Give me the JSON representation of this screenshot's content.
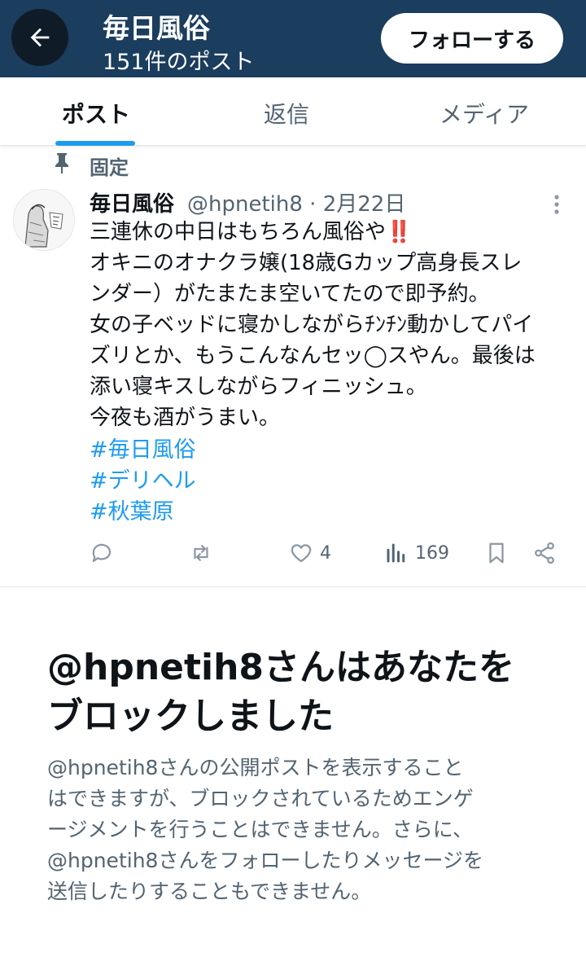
{
  "header": {
    "title": "毎日風俗",
    "post_count": "151件のポスト",
    "follow_label": "フォローする",
    "back_icon": "arrow-left-icon",
    "bg_color": "#1b3d5e"
  },
  "tabs": [
    {
      "label": "ポスト",
      "active": true
    },
    {
      "label": "返信",
      "active": false
    },
    {
      "label": "メディア",
      "active": false
    }
  ],
  "pinned_label": "固定",
  "tweet": {
    "display_name": "毎日風俗",
    "handle_date": "@hpnetih8 · 2月22日",
    "body_lines": [
      "三連休の中日はもちろん風俗や‼️",
      "オキニのオナクラ嬢(18歳Gカップ高身長スレ",
      "ンダー）がたまたま空いてたので即予約。",
      "女の子ベッドに寝かしながらﾁﾝﾁﾝ動かしてパイ",
      "ズリとか、もうこんなんセッ◯スやん。最後は",
      "添い寝キスしながらフィニッシュ。",
      "今夜も酒がうまい。"
    ],
    "hashtags": [
      "#毎日風俗",
      "#デリヘル",
      "#秋葉原"
    ],
    "likes": "4",
    "views": "169",
    "accent_color": "#1d9bf0"
  },
  "blocked": {
    "title_line1": "@hpnetih8さんはあなたを",
    "title_line2": "ブロックしました",
    "desc_lines": [
      "@hpnetih8さんの公開ポストを表示すること",
      "はできますが、ブロックされているためエンゲ",
      "ージメントを行うことはできません。さらに、",
      "@hpnetih8さんをフォローしたりメッセージを",
      "送信したりすることもできません。"
    ]
  }
}
